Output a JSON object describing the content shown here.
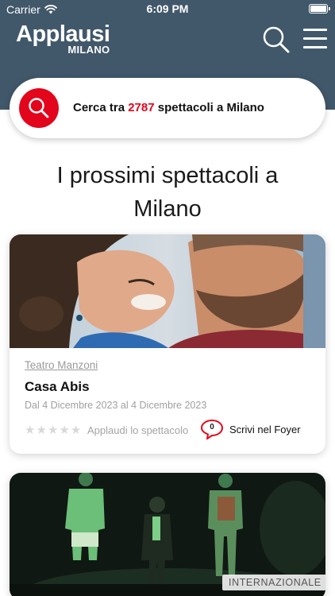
{
  "status_bar": {
    "carrier": "Carrier",
    "time": "6:09 PM"
  },
  "header": {
    "logo_main": "Applausi",
    "logo_sub": "MILANO",
    "background": "#41586a",
    "search_icon": "search-icon",
    "menu_icon": "hamburger-menu-icon"
  },
  "search": {
    "prefix": "Cerca tra ",
    "count": "2787",
    "suffix": " spettacoli a Milano",
    "accent": "#e3051b"
  },
  "section": {
    "title": "I prossimi spettacoli a Milano"
  },
  "cards": [
    {
      "venue": "Teatro Manzoni",
      "title": "Casa Abis",
      "dates": "Dal 4 Dicembre 2023 al 4 Dicembre 2023",
      "stars": "★★★★★",
      "rating_label": "Applaudi lo spettacolo",
      "comments_count": "0",
      "foyer_label": "Scrivi nel Foyer"
    },
    {
      "tag": "INTERNAZIONALE"
    }
  ]
}
